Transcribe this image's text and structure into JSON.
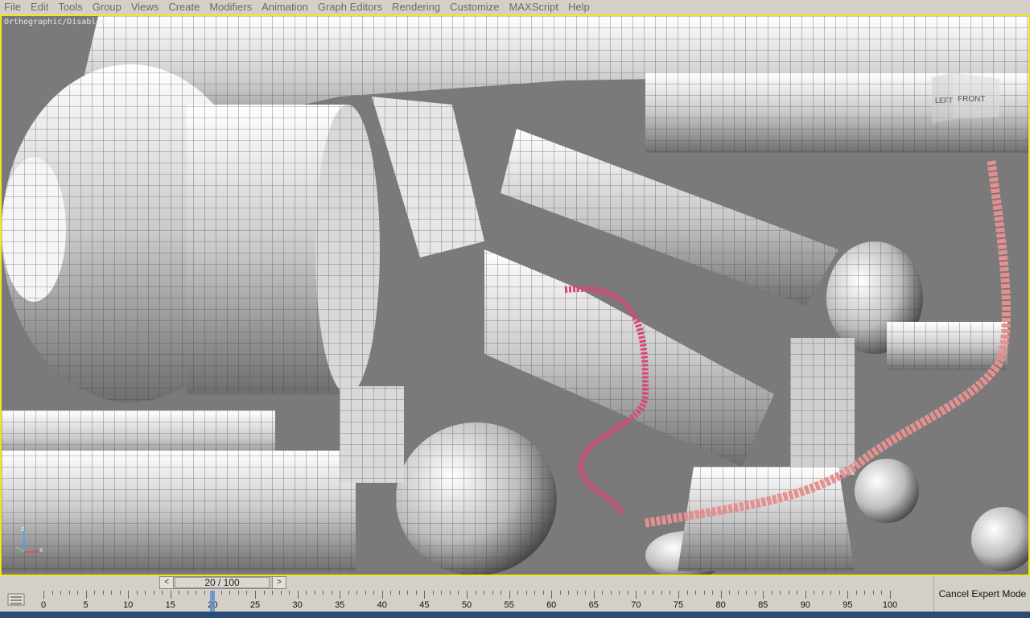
{
  "menu": [
    "File",
    "Edit",
    "Tools",
    "Group",
    "Views",
    "Create",
    "Modifiers",
    "Animation",
    "Graph Editors",
    "Rendering",
    "Customize",
    "MAXScript",
    "Help"
  ],
  "viewport": {
    "label": "Orthographic/Disabled",
    "viewcube": {
      "left": "LEFT",
      "front": "FRONT"
    },
    "axis": {
      "z": "z",
      "x": "x"
    },
    "colors": {
      "background": "#7a7a7a",
      "border": "#f3e51a",
      "cable_dark": "#d8457e",
      "cable_light": "#e59090"
    }
  },
  "time_slider": {
    "label": "20 / 100",
    "current": 20,
    "total": 100,
    "prev": "<",
    "next": ">"
  },
  "ruler": {
    "labels": [
      "0",
      "5",
      "10",
      "15",
      "20",
      "25",
      "30",
      "35",
      "40",
      "45",
      "50",
      "55",
      "60",
      "65",
      "70",
      "75",
      "80",
      "85",
      "90",
      "95",
      "100"
    ]
  },
  "expert_button": "Cancel Expert Mode"
}
